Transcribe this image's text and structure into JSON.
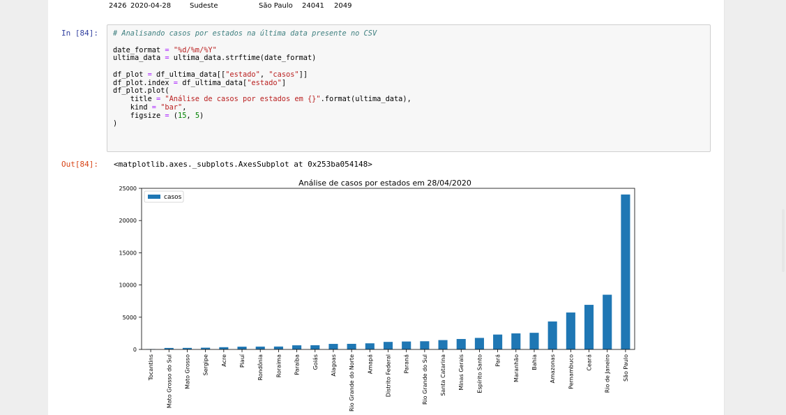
{
  "prev_row": {
    "index": "2426",
    "date": "2020-04-28",
    "region": "Sudeste",
    "state": "São Paulo",
    "cases": "24041",
    "deaths": "2049"
  },
  "cell_in": {
    "prompt": "In [84]:",
    "lines": [
      [
        {
          "t": "# Analisando casos por estados na última data presente no CSV",
          "c": "cm"
        }
      ],
      [],
      [
        {
          "t": "date_format "
        },
        {
          "t": "=",
          "c": "op"
        },
        {
          "t": " "
        },
        {
          "t": "\"%d/%m/%Y\"",
          "c": "st"
        }
      ],
      [
        {
          "t": "ultima_data "
        },
        {
          "t": "=",
          "c": "op"
        },
        {
          "t": " ultima_data.strftime(date_format)"
        }
      ],
      [],
      [
        {
          "t": "df_plot "
        },
        {
          "t": "=",
          "c": "op"
        },
        {
          "t": " df_ultima_data[["
        },
        {
          "t": "\"estado\"",
          "c": "st"
        },
        {
          "t": ", "
        },
        {
          "t": "\"casos\"",
          "c": "st"
        },
        {
          "t": "]]"
        }
      ],
      [
        {
          "t": "df_plot.index "
        },
        {
          "t": "=",
          "c": "op"
        },
        {
          "t": " df_ultima_data["
        },
        {
          "t": "\"estado\"",
          "c": "st"
        },
        {
          "t": "]"
        }
      ],
      [
        {
          "t": "df_plot.plot("
        }
      ],
      [
        {
          "t": "    title "
        },
        {
          "t": "=",
          "c": "op"
        },
        {
          "t": " "
        },
        {
          "t": "\"Análise de casos por estados em {}\"",
          "c": "st"
        },
        {
          "t": ".format(ultima_data),"
        }
      ],
      [
        {
          "t": "    kind "
        },
        {
          "t": "=",
          "c": "op"
        },
        {
          "t": " "
        },
        {
          "t": "\"bar\"",
          "c": "st"
        },
        {
          "t": ","
        }
      ],
      [
        {
          "t": "    figsize "
        },
        {
          "t": "=",
          "c": "op"
        },
        {
          "t": " ("
        },
        {
          "t": "15",
          "c": "nm"
        },
        {
          "t": ", "
        },
        {
          "t": "5",
          "c": "nm"
        },
        {
          "t": ")"
        }
      ],
      [
        {
          "t": ")"
        }
      ]
    ]
  },
  "cell_out": {
    "prompt": "Out[84]:",
    "text": "<matplotlib.axes._subplots.AxesSubplot at 0x253ba054148>"
  },
  "colors": {
    "bar": "#1f77b4",
    "in_prompt": "#303f9f",
    "out_prompt": "#d84315"
  },
  "chart_data": {
    "type": "bar",
    "title": "Análise de casos por estados em 28/04/2020",
    "xlabel": "",
    "ylabel": "",
    "legend": {
      "entries": [
        "casos"
      ],
      "placement": "top-left"
    },
    "ylim": [
      0,
      25000
    ],
    "yticks": [
      0,
      5000,
      10000,
      15000,
      20000,
      25000
    ],
    "grid": false,
    "categories": [
      "Tocantins",
      "Mato Grosso do Sul",
      "Mato Grosso",
      "Sergipe",
      "Acre",
      "Piauí",
      "Rondônia",
      "Roraima",
      "Paraíba",
      "Goiás",
      "Alagoas",
      "Rio Grande do Norte",
      "Amapá",
      "Distrito Federal",
      "Paraná",
      "Rio Grande do Sul",
      "Santa Catarina",
      "Minas Gerais",
      "Espírito Santo",
      "Pará",
      "Maranhão",
      "Bahia",
      "Amazonas",
      "Pernambuco",
      "Ceará",
      "Rio de Janeiro",
      "São Paulo"
    ],
    "series": [
      {
        "name": "casos",
        "values": [
          50,
          230,
          240,
          270,
          350,
          430,
          440,
          450,
          640,
          650,
          860,
          870,
          950,
          1170,
          1230,
          1270,
          1450,
          1620,
          1790,
          2310,
          2490,
          2580,
          4340,
          5730,
          6920,
          8490,
          24041
        ]
      }
    ]
  }
}
